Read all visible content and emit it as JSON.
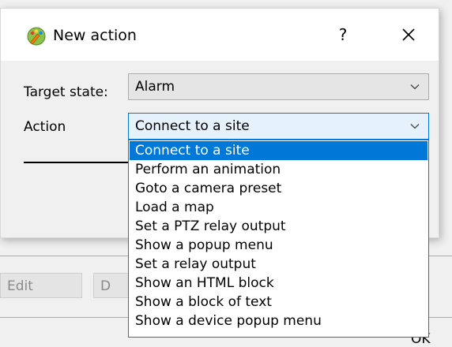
{
  "dialog": {
    "title": "New action",
    "help_label": "?",
    "target_state": {
      "label": "Target state:",
      "value": "Alarm"
    },
    "action": {
      "label": "Action",
      "value": "Connect to a site"
    },
    "dropdown_options": [
      "Connect to a site",
      "Perform an animation",
      "Goto a camera preset",
      "Load a map",
      "Set a PTZ relay output",
      "Show a popup menu",
      "Set a relay output",
      "Show an HTML block",
      "Show a block of text",
      "Show a device popup menu"
    ],
    "selected_index": 0
  },
  "background": {
    "edit_button_label": "Edit",
    "second_button_partial_label": "D",
    "ok_button_partial_label": "OK"
  },
  "colors": {
    "selection": "#0078d7",
    "focus_combo_bg": "#e5f1fb"
  },
  "icons": {
    "title": "pencil-palette-icon",
    "close": "close-icon",
    "combo_arrow": "chevron-down-icon"
  }
}
